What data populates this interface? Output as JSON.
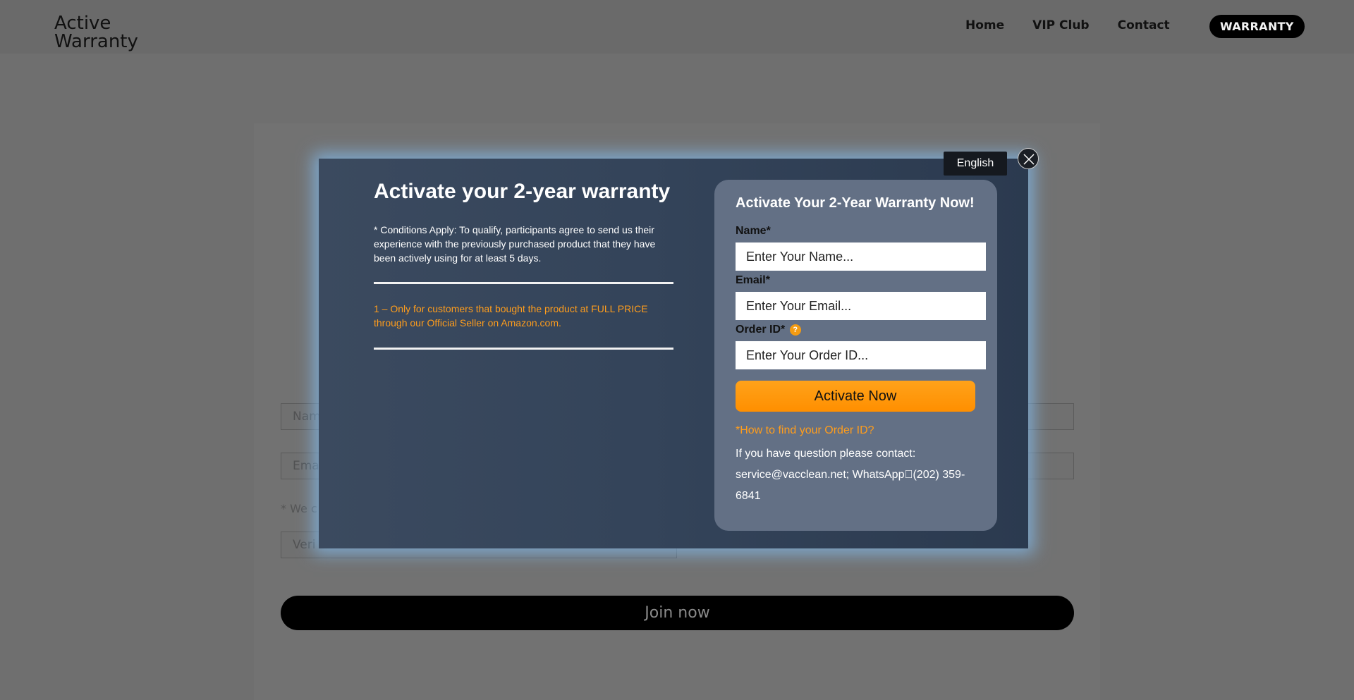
{
  "header": {
    "logo_line1": "Active",
    "logo_line2": "Warranty",
    "nav": [
      "Home",
      "VIP Club",
      "Contact"
    ],
    "warranty_button": "WARRANTY"
  },
  "background_form": {
    "name_placeholder": "Nam",
    "email_placeholder": "Ema",
    "note": "* We c",
    "verify_placeholder": "Veri",
    "join_button": "Join now"
  },
  "modal": {
    "title": "Activate your 2-year warranty",
    "conditions": "* Conditions Apply: To qualify, participants agree to send us their experience with the previously purchased product that they have been actively using for at least 5 days.",
    "note": "1 – Only for customers that bought the product at FULL PRICE through our Official Seller on Amazon.com.",
    "language": "English",
    "form": {
      "title": "Activate Your 2-Year Warranty Now!",
      "name_label": "Name*",
      "name_placeholder": "Enter Your Name...",
      "email_label": "Email*",
      "email_placeholder": "Enter Your Email...",
      "order_label": "Order ID*",
      "order_help": "?",
      "order_placeholder": "Enter Your Order ID...",
      "submit": "Activate Now",
      "find_order_link": "*How to find your Order ID?",
      "contact_text": "If you have question please contact: service@vacclean.net; WhatsApp\u0000(202) 359-6841"
    }
  },
  "colors": {
    "accent_orange": "#ff9d1c",
    "modal_bg": "#34445a",
    "form_card_bg": "#637085",
    "glow": "#82b9eb"
  },
  "icons": {
    "close": "close-icon",
    "help": "help-icon"
  }
}
